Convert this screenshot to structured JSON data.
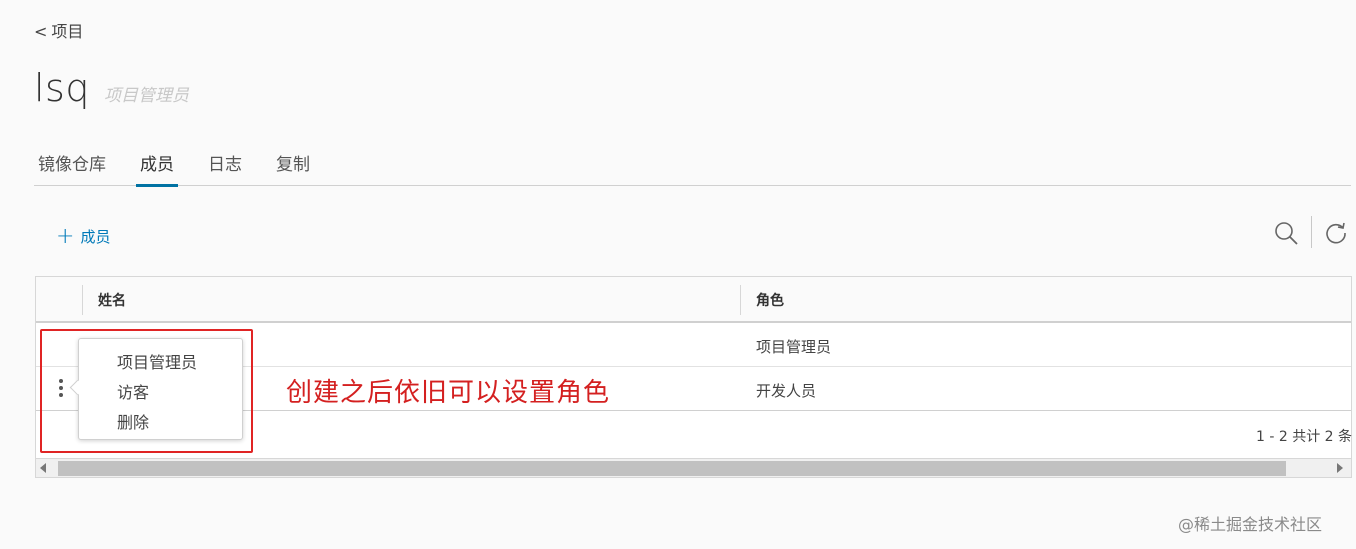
{
  "breadcrumb": {
    "chevron": "<",
    "label": "项目"
  },
  "header": {
    "title": "lsq",
    "role": "项目管理员"
  },
  "tabs": [
    {
      "label": "镜像仓库",
      "active": false
    },
    {
      "label": "成员",
      "active": true
    },
    {
      "label": "日志",
      "active": false
    },
    {
      "label": "复制",
      "active": false
    }
  ],
  "toolbar": {
    "add_label": "成员",
    "add_icon": "plus-icon",
    "search_icon": "search-icon",
    "refresh_icon": "refresh-icon"
  },
  "table": {
    "columns": [
      "姓名",
      "角色"
    ],
    "rows": [
      {
        "name": "",
        "role": "项目管理员"
      },
      {
        "name": "",
        "role": "开发人员"
      }
    ],
    "footer": "1 - 2 共计 2 条"
  },
  "context_menu": {
    "items": [
      "项目管理员",
      "访客",
      "删除"
    ]
  },
  "annotation": {
    "text": "创建之后依旧可以设置角色",
    "color": "#d42020"
  },
  "watermark": "@稀土掘金技术社区",
  "colors": {
    "accent": "#0079b8",
    "tab_underline": "#0072a3",
    "annotation_red": "#e02424"
  }
}
